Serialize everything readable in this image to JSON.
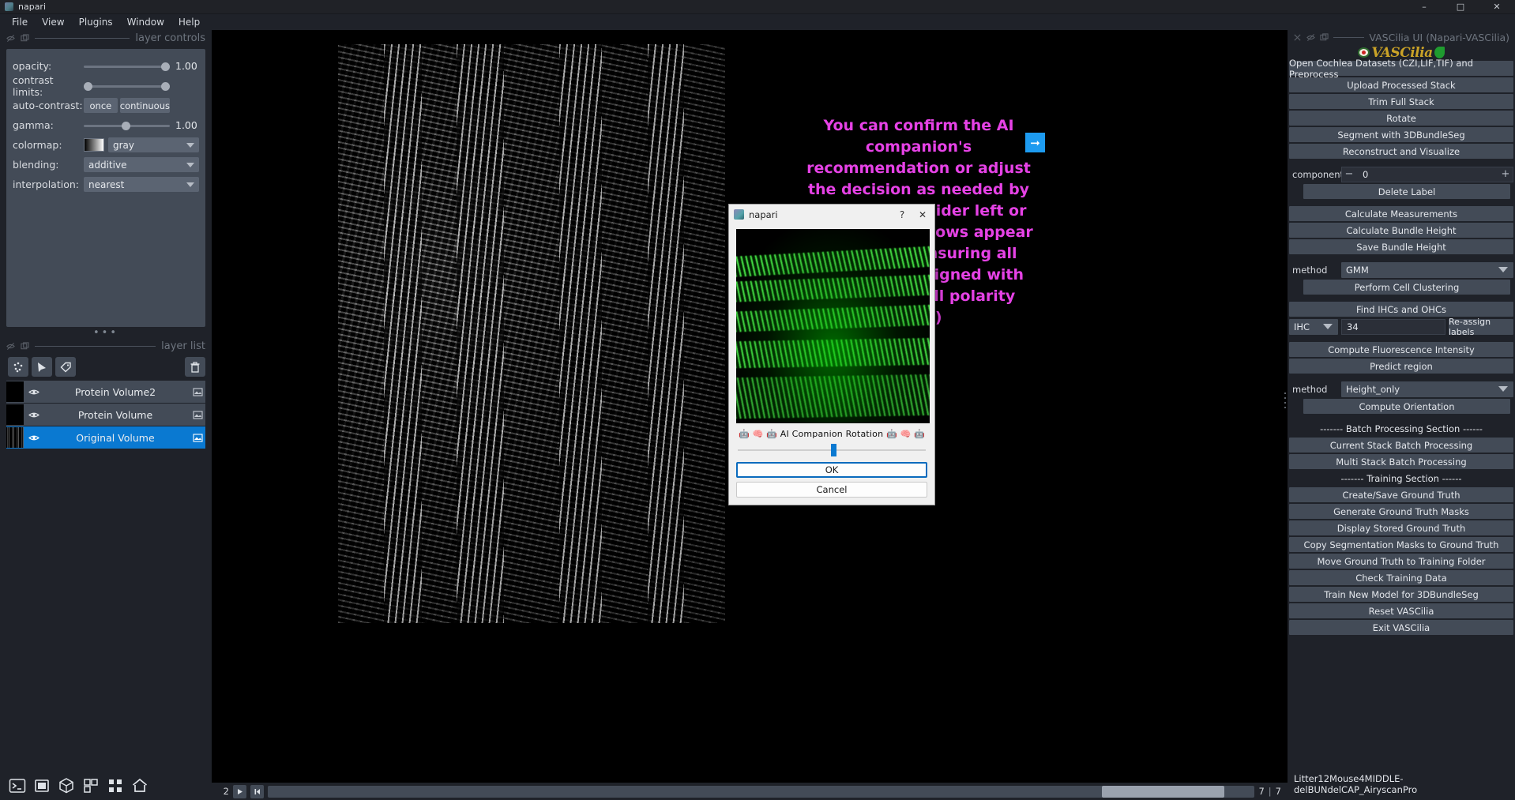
{
  "window": {
    "title": "napari",
    "icon": "napari-logo-icon",
    "buttons": {
      "minimize": "–",
      "maximize": "□",
      "close": "✕"
    }
  },
  "menubar": {
    "items": [
      "File",
      "View",
      "Plugins",
      "Window",
      "Help"
    ]
  },
  "layer_controls": {
    "panel_title": "layer controls",
    "rows": [
      {
        "label": "opacity:",
        "value": "1.00",
        "type": "slider",
        "knob_pct": 100
      },
      {
        "label": "contrast limits:",
        "value": "",
        "type": "range",
        "knob_pct": 0
      },
      {
        "label": "auto-contrast:",
        "type": "buttons",
        "buttons": [
          "once",
          "continuous"
        ]
      },
      {
        "label": "gamma:",
        "value": "1.00",
        "type": "slider",
        "knob_pct": 44
      },
      {
        "label": "colormap:",
        "type": "colormap",
        "selected": "gray"
      },
      {
        "label": "blending:",
        "type": "combo",
        "selected": "additive"
      },
      {
        "label": "interpolation:",
        "type": "combo",
        "selected": "nearest"
      }
    ]
  },
  "layer_list": {
    "panel_title": "layer list",
    "tool_icons": [
      "points-icon",
      "shapes-icon",
      "labels-icon"
    ],
    "delete_icon": "trash-icon",
    "layers": [
      {
        "name": "Protein Volume2",
        "visible": true,
        "selected": false,
        "thumb": "black"
      },
      {
        "name": "Protein Volume",
        "visible": true,
        "selected": false,
        "thumb": "black"
      },
      {
        "name": "Original Volume",
        "visible": true,
        "selected": true,
        "thumb": "noise"
      }
    ]
  },
  "left_bottom_bar": {
    "icons": [
      "console-icon",
      "ndisplay-2d-icon",
      "ndisplay-3d-icon",
      "roll-dims-icon",
      "grid-view-icon",
      "home-icon"
    ]
  },
  "annotation": {
    "text": "You can confirm the AI companion's recommendation or adjust the decision as needed by scrolling the slider left or right until the rows appear horizontal, ensuring all bundles are aligned with the planer cell polarity (PCP)",
    "color": "#e642e6",
    "next_arrow_icon": "arrow-right-icon",
    "next_arrow_color": "#1d9bf0"
  },
  "playbar": {
    "current_index": "2",
    "play_icon": "play-icon",
    "step_icon": "step-start-icon",
    "separator": "|",
    "value": "7",
    "max": "7"
  },
  "dialog": {
    "title": "napari",
    "icon": "napari-logo-icon",
    "help_button": "?",
    "close_button": "✕",
    "preview_alt": "green-fluorescence-preview",
    "slider_label": "🤖 🧠 🤖 AI Companion Rotation 🤖 🧠 🤖",
    "slider_position_pct": 49,
    "ok_label": "OK",
    "cancel_label": "Cancel"
  },
  "vascilia": {
    "panel_title": "VASCilia UI (Napari-VASCilia)",
    "logo_text": "VASCilia",
    "header_icons": [
      "close-icon",
      "float-icon",
      "collapse-icon"
    ],
    "buttons_top": [
      "Open Cochlea Datasets (CZI,LIF,TIF) and Preprocess",
      "Upload Processed Stack",
      "Trim Full Stack",
      "Rotate",
      "Segment with 3DBundleSeg",
      "Reconstruct and Visualize"
    ],
    "component": {
      "label": "component",
      "value": "0",
      "minus": "−",
      "plus": "+"
    },
    "delete_label_button": "Delete Label",
    "buttons_measure": [
      "Calculate Measurements",
      "Calculate Bundle Height",
      "Save Bundle Height"
    ],
    "method_cluster": {
      "label": "method",
      "value": "GMM"
    },
    "perform_clustering_button": "Perform Cell Clustering",
    "find_cells_button": "Find IHCs and OHCs",
    "reassign_row": {
      "type": "IHC",
      "count": "34",
      "button": "Re-assign labels"
    },
    "buttons_analysis": [
      "Compute Fluorescence Intensity",
      "Predict region"
    ],
    "method_orientation": {
      "label": "method",
      "value": "Height_only"
    },
    "compute_orientation_button": "Compute Orientation",
    "batch_section_label": "------- Batch Processing Section ------",
    "buttons_batch": [
      "Current Stack Batch Processing",
      "Multi Stack Batch Processing"
    ],
    "training_section_label": "------- Training Section ------",
    "buttons_training": [
      "Create/Save Ground Truth",
      "Generate Ground Truth Masks",
      "Display Stored Ground Truth",
      "Copy Segmentation Masks to Ground Truth",
      "Move Ground Truth to Training Folder",
      "Check Training Data",
      "Train New Model for 3DBundleSeg",
      "Reset VASCilia",
      "Exit VASCilia"
    ],
    "status_text": "Litter12Mouse4MIDDLE-delBUNdelCAP_AiryscanPro"
  }
}
